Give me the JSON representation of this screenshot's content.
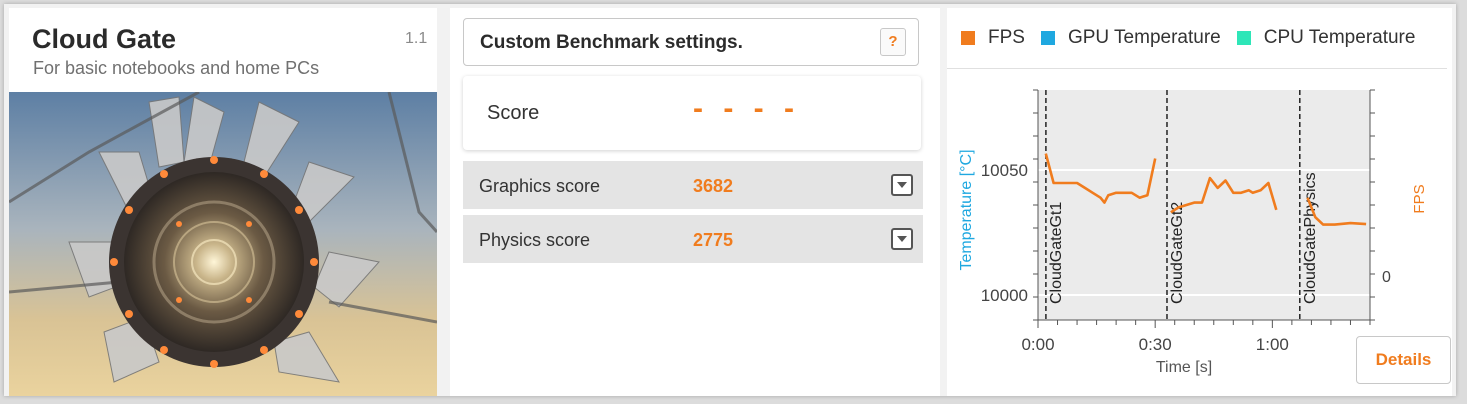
{
  "benchmark": {
    "title": "Cloud Gate",
    "version": "1.1",
    "subtitle": "For basic notebooks and home PCs"
  },
  "settings": {
    "label": "Custom Benchmark settings.",
    "help_label": "?"
  },
  "score": {
    "label": "Score",
    "value": "- - - -"
  },
  "sub_scores": [
    {
      "label": "Graphics score",
      "value": "3682"
    },
    {
      "label": "Physics score",
      "value": "2775"
    }
  ],
  "legend": [
    {
      "label": "FPS",
      "color": "#f07c1e"
    },
    {
      "label": "GPU Temperature",
      "color": "#1fa8e0"
    },
    {
      "label": "CPU Temperature",
      "color": "#2ee6b8"
    }
  ],
  "details_label": "Details",
  "chart_data": {
    "type": "line",
    "xlabel": "Time [s]",
    "ylabel_left": "Temperature [°C]",
    "ylabel_right": "FPS",
    "x_ticks": [
      "0:00",
      "0:30",
      "1:00"
    ],
    "y_ticks_left": [
      "10050",
      "10000"
    ],
    "y_ticks_right": [
      "0"
    ],
    "xlim": [
      0,
      85
    ],
    "ylim_left": [
      9990,
      10082
    ],
    "ylim_right": [
      -9,
      38
    ],
    "grid": true,
    "sections": [
      {
        "label": "CloudGateGt1",
        "x": 1
      },
      {
        "label": "CloudGateGt2",
        "x": 32
      },
      {
        "label": "CloudGatePhysics",
        "x": 66
      }
    ],
    "series": [
      {
        "name": "FPS",
        "color": "#f07c1e",
        "axis": "right",
        "segments": [
          [
            [
              2,
              25
            ],
            [
              4,
              19
            ],
            [
              5,
              19
            ],
            [
              8,
              19
            ],
            [
              10,
              19
            ],
            [
              12,
              18
            ],
            [
              14,
              17
            ],
            [
              16,
              16
            ],
            [
              17,
              15
            ],
            [
              18,
              16.5
            ],
            [
              20,
              17
            ],
            [
              22,
              17
            ],
            [
              24,
              17
            ],
            [
              26,
              16
            ],
            [
              28,
              16.5
            ],
            [
              30,
              24
            ]
          ],
          [
            [
              34,
              13
            ],
            [
              36,
              14
            ],
            [
              38,
              14.5
            ],
            [
              40,
              15
            ],
            [
              42,
              15
            ],
            [
              44,
              20
            ],
            [
              46,
              18
            ],
            [
              48,
              19.5
            ],
            [
              50,
              17
            ],
            [
              52,
              17
            ],
            [
              54,
              17.5
            ],
            [
              55,
              17
            ],
            [
              57,
              17.5
            ],
            [
              59,
              19
            ],
            [
              61,
              13.5
            ]
          ],
          [
            [
              69,
              16
            ],
            [
              71,
              12
            ],
            [
              73,
              10.5
            ],
            [
              76,
              10.5
            ],
            [
              80,
              10.8
            ],
            [
              84,
              10.6
            ]
          ]
        ]
      }
    ]
  }
}
